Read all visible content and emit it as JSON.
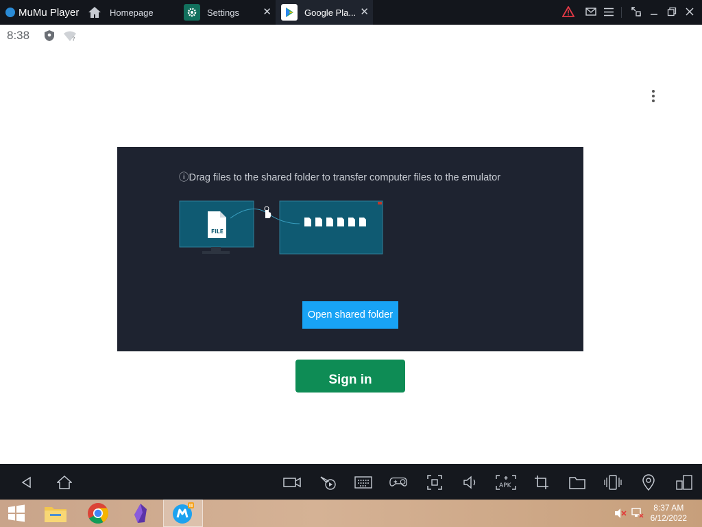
{
  "titlebar": {
    "app_name": "MuMu Player",
    "tabs": [
      {
        "label": "Homepage"
      },
      {
        "label": "Settings",
        "close": "✕"
      },
      {
        "label": "Google Pla...",
        "close": "✕"
      }
    ]
  },
  "status_bar": {
    "time": "8:38"
  },
  "page": {
    "signin_label": "Sign in"
  },
  "shared_folder_dialog": {
    "hint": "ⓘDrag files to the shared folder to transfer computer files to the emulator",
    "file_label": "FILE",
    "open_button_label": "Open shared folder"
  },
  "taskbar": {
    "time": "8:37 AM",
    "date": "6/12/2022"
  },
  "colors": {
    "accent": "#18a3f5",
    "signin_green": "#0e8c55",
    "dialog_bg": "#1e2330",
    "illustration_teal": "#0f5a72"
  }
}
